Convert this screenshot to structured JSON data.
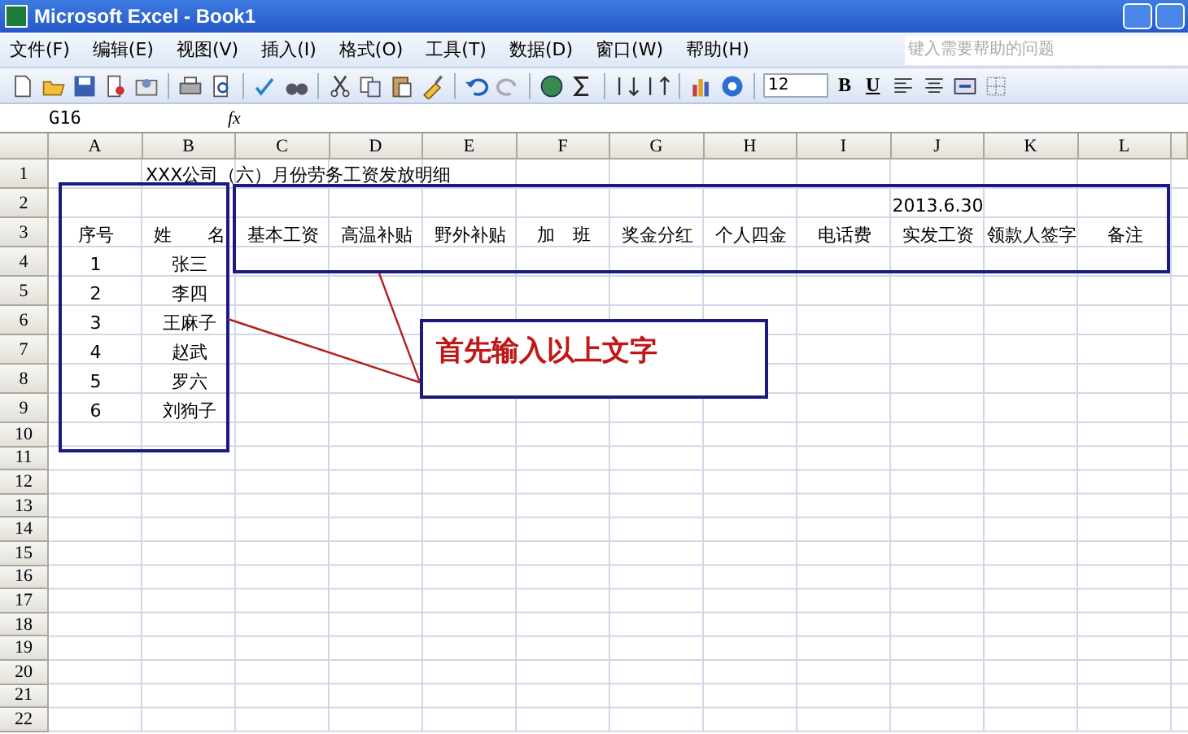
{
  "window": {
    "title": "Microsoft Excel - Book1"
  },
  "menu": [
    "文件(F)",
    "编辑(E)",
    "视图(V)",
    "插入(I)",
    "格式(O)",
    "工具(T)",
    "数据(D)",
    "窗口(W)",
    "帮助(H)"
  ],
  "help_search": {
    "placeholder": "键入需要帮助的问题"
  },
  "toolbar": {
    "font_size": "12",
    "bold": "B",
    "underline": "U"
  },
  "formula_bar": {
    "name_box": "G16",
    "fx": "fx"
  },
  "columns": [
    "A",
    "B",
    "C",
    "D",
    "E",
    "F",
    "G",
    "H",
    "I",
    "J",
    "K",
    "L"
  ],
  "rows": [
    {
      "number": "1",
      "cells": {
        "b": "XXX公司（六）月份劳务工资发放明细"
      }
    },
    {
      "number": "2",
      "cells": {
        "j": "2013.6.30"
      }
    },
    {
      "number": "3",
      "cells": {
        "a": "序号",
        "b": "姓　　名",
        "c": "基本工资",
        "d": "高温补贴",
        "e": "野外补贴",
        "f": "加　班",
        "g": "奖金分红",
        "h": "个人四金",
        "i": "电话费",
        "j": "实发工资",
        "k": "领款人签字",
        "l": "备注"
      }
    },
    {
      "number": "4",
      "cells": {
        "a": "1",
        "b": "张三"
      }
    },
    {
      "number": "5",
      "cells": {
        "a": "2",
        "b": "李四"
      }
    },
    {
      "number": "6",
      "cells": {
        "a": "3",
        "b": "王麻子"
      }
    },
    {
      "number": "7",
      "cells": {
        "a": "4",
        "b": "赵武"
      }
    },
    {
      "number": "8",
      "cells": {
        "a": "5",
        "b": "罗六"
      }
    },
    {
      "number": "9",
      "cells": {
        "a": "6",
        "b": "刘狗子"
      }
    },
    {
      "number": "10"
    },
    {
      "number": "11"
    },
    {
      "number": "12"
    },
    {
      "number": "13"
    },
    {
      "number": "14"
    },
    {
      "number": "15"
    },
    {
      "number": "16"
    },
    {
      "number": "17"
    },
    {
      "number": "18"
    },
    {
      "number": "19"
    },
    {
      "number": "20"
    },
    {
      "number": "21"
    },
    {
      "number": "22"
    }
  ],
  "annotation": {
    "callout": "首先输入以上文字"
  }
}
